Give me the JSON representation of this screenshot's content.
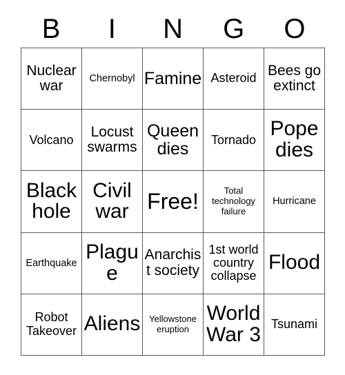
{
  "card": {
    "type": "bingo-card",
    "columns": 5,
    "rows": 5,
    "border_color": "#595959",
    "background_color": "#ffffff",
    "text_color": "#000000"
  },
  "header": {
    "letters": [
      "B",
      "I",
      "N",
      "G",
      "O"
    ]
  },
  "grid": {
    "cells": [
      {
        "text": "Nuclear war",
        "size": "l"
      },
      {
        "text": "Chernobyl",
        "size": "s"
      },
      {
        "text": "Famine",
        "size": "xl"
      },
      {
        "text": "Asteroid",
        "size": "m"
      },
      {
        "text": "Bees go extinct",
        "size": "l"
      },
      {
        "text": "Volcano",
        "size": "m"
      },
      {
        "text": "Locust swarms",
        "size": "l"
      },
      {
        "text": "Queen dies",
        "size": "xl"
      },
      {
        "text": "Tornado",
        "size": "m"
      },
      {
        "text": "Pope dies",
        "size": "xxl"
      },
      {
        "text": "Black hole",
        "size": "xxl"
      },
      {
        "text": "Civil war",
        "size": "xxl"
      },
      {
        "text": "Free!",
        "size": "xxxl"
      },
      {
        "text": "Total technology failure",
        "size": "xs"
      },
      {
        "text": "Hurricane",
        "size": "s"
      },
      {
        "text": "Earthquake",
        "size": "s"
      },
      {
        "text": "Plague",
        "size": "xxl"
      },
      {
        "text": "Anarchist society",
        "size": "l"
      },
      {
        "text": "1st world country collapse",
        "size": "m"
      },
      {
        "text": "Flood",
        "size": "xxl"
      },
      {
        "text": "Robot Takeover",
        "size": "m"
      },
      {
        "text": "Aliens",
        "size": "xxl"
      },
      {
        "text": "Yellowstone eruption",
        "size": "xs"
      },
      {
        "text": "World War 3",
        "size": "xxl"
      },
      {
        "text": "Tsunami",
        "size": "m"
      }
    ]
  }
}
